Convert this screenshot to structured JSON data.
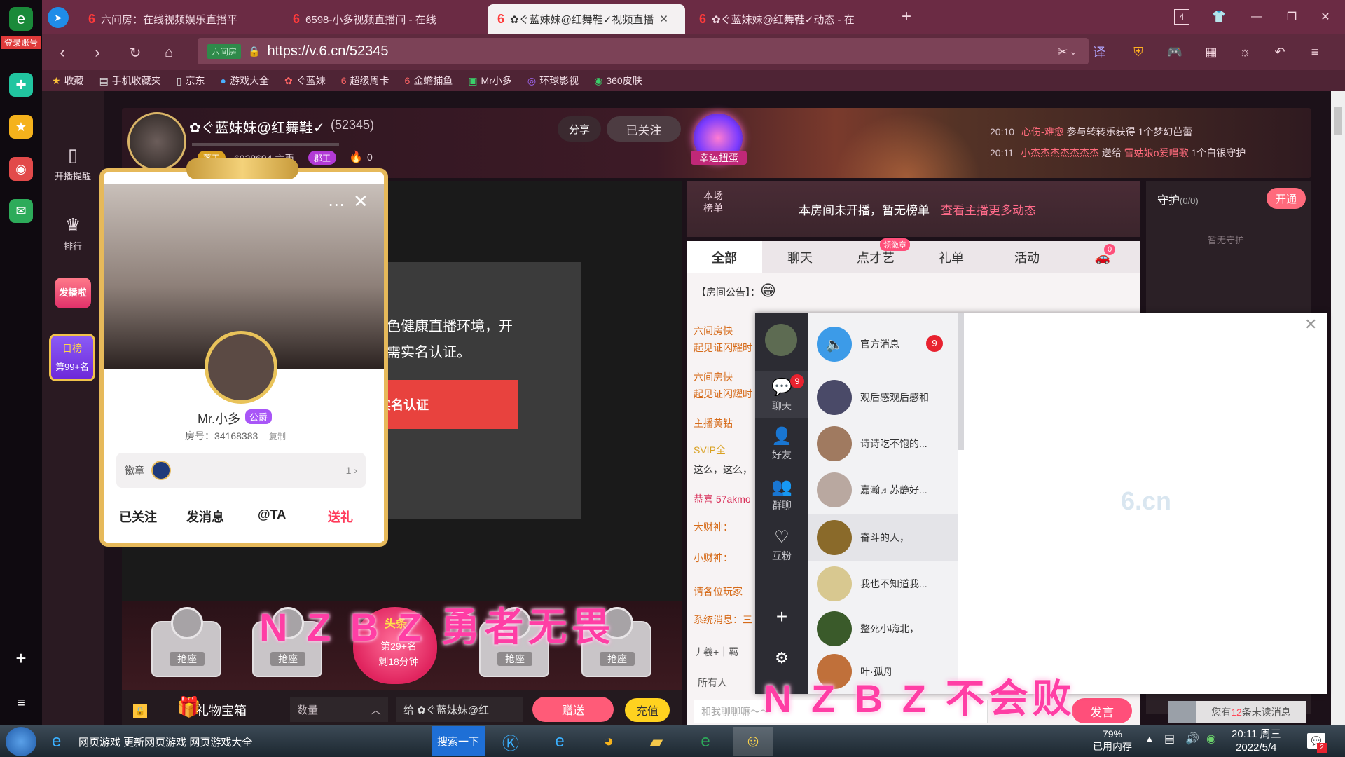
{
  "sysbar": {
    "login": "登录账号"
  },
  "tabs": [
    {
      "label": "六间房：在线视频娱乐直播平",
      "active": false
    },
    {
      "label": "6598-小多视频直播间 - 在线",
      "active": false
    },
    {
      "label": "✿ぐ蓝妹妹@红舞鞋✓视频直播",
      "active": true
    },
    {
      "label": "✿ぐ蓝妹妹@红舞鞋✓动态 - 在",
      "active": false
    }
  ],
  "browser": {
    "url": "https://v.6.cn/52345",
    "url_tag": "六间房",
    "tab_count": "4"
  },
  "bookmarks": [
    "收藏",
    "手机收藏夹",
    "京东",
    "游戏大全",
    "ぐ蓝妹",
    "超级周卡",
    "金蟾捕鱼",
    "Mr小多",
    "环球影视",
    "360皮肤"
  ],
  "leftnav": {
    "items": [
      "开播提醒",
      "排行",
      "发播啦",
      "日榜",
      "第99+名"
    ]
  },
  "header": {
    "anchor_name": "✿ぐ蓝妹妹@红舞鞋✓",
    "anchor_id": "(52345)",
    "badge_1": "蓬王",
    "coins": "6938694 六币",
    "badge_2": "郡王",
    "fire": "0",
    "share": "分享",
    "followed": "已关注",
    "lucky": "幸运扭蛋"
  },
  "feed": [
    {
      "time": "20:10",
      "user": "心伤-难愈",
      "text": "参与转转乐获得",
      "item": "1个梦幻芭蕾"
    },
    {
      "time": "20:11",
      "user": "小杰杰杰杰杰杰杰",
      "text": "送给",
      "target": "雪姑娘o爱唱歌",
      "item": "1个白银守护"
    }
  ],
  "video": {
    "notice_line1": "绿色健康直播环境，开",
    "notice_line2": "播需实名认证。",
    "verify": "实名认证"
  },
  "seats": {
    "label": "抢座",
    "heart_top": "头条",
    "rank": "第29+名",
    "remain": "剩18分钟"
  },
  "giftbar": {
    "box": "礼物宝箱",
    "qty": "数量",
    "to": "给 ✿ぐ蓝妹妹@红",
    "send": "赠送",
    "recharge": "充值"
  },
  "ranking": {
    "label": "本场榜单",
    "text": "本房间未开播，暂无榜单",
    "link": "查看主播更多动态"
  },
  "guard": {
    "title": "守护",
    "count": "(0/0)",
    "open": "开通",
    "empty": "暂无守护",
    "unread_pre": "您有",
    "unread_n": "12",
    "unread_post": "条未读消息"
  },
  "chat_tabs": [
    "全部",
    "聊天",
    "点才艺",
    "礼单",
    "活动"
  ],
  "chat_tab_badge": "领徽章",
  "car_badge": "0",
  "chat": {
    "notice": "【房间公告】：",
    "msgs": [
      "六间房快",
      "起见证闪耀时",
      "六间房快",
      "起见证闪耀时",
      "主播黄钻",
      "SVIP全",
      "这么，这么，",
      "恭喜 57akmo",
      "大财神：",
      "小财神：",
      "请各位玩家",
      "系统消息：三",
      "丿羲+｜羁"
    ],
    "all_people": "所有人",
    "placeholder": "和我聊聊嘛～～",
    "post": "发言"
  },
  "im": {
    "nav": [
      "聊天",
      "好友",
      "群聊",
      "互粉"
    ],
    "nav_badge": "9",
    "official": "官方消息",
    "official_badge": "9",
    "convs": [
      "观后感观后感和",
      "诗诗吃不饱的...",
      "嘉瀚♬苏静好...",
      "奋斗的人，",
      "我也不知道我...",
      "整死小嗨北，",
      "叶·孤舟"
    ],
    "watermark": "6.cn"
  },
  "card": {
    "name": "Mr.小多",
    "role": "公爵",
    "room": "房号：34168383",
    "copy": "复制",
    "badge_label": "徽章",
    "badge_count": "1",
    "actions": [
      "已关注",
      "发消息",
      "@TA",
      "送礼"
    ]
  },
  "overlay": {
    "line1": "N Z B Z 勇者无畏",
    "line2": "N Z B Z 不会败"
  },
  "taskbar": {
    "browser_title": "网页游戏 更新网页游戏 网页游戏大全",
    "search": "搜索一下",
    "mem": "79%",
    "mem_label": "已用内存",
    "time": "20:11 周三",
    "date": "2022/5/4",
    "notif": "2"
  }
}
